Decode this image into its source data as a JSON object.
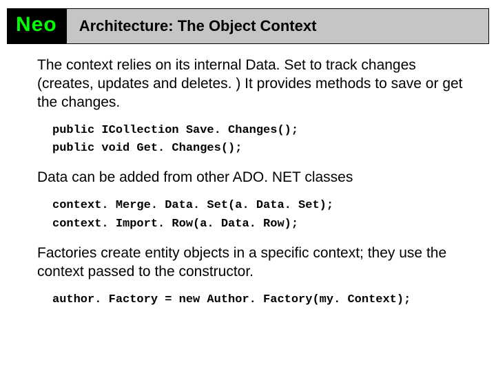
{
  "header": {
    "logo": "Neo",
    "title": "Architecture: The Object Context"
  },
  "body": {
    "para1": "The context relies on its internal Data. Set to track changes (creates, updates and deletes. ) It provides methods to save or get the changes.",
    "code1": {
      "line1": "public ICollection Save. Changes();",
      "line2": "public void Get. Changes();"
    },
    "para2": "Data can be added from other ADO. NET classes",
    "code2": {
      "line1": "context. Merge. Data. Set(a. Data. Set);",
      "line2": "context. Import. Row(a. Data. Row);"
    },
    "para3": "Factories create entity objects in a specific context; they use the context passed to the constructor.",
    "code3": {
      "line1": "author. Factory = new Author. Factory(my. Context);"
    }
  }
}
